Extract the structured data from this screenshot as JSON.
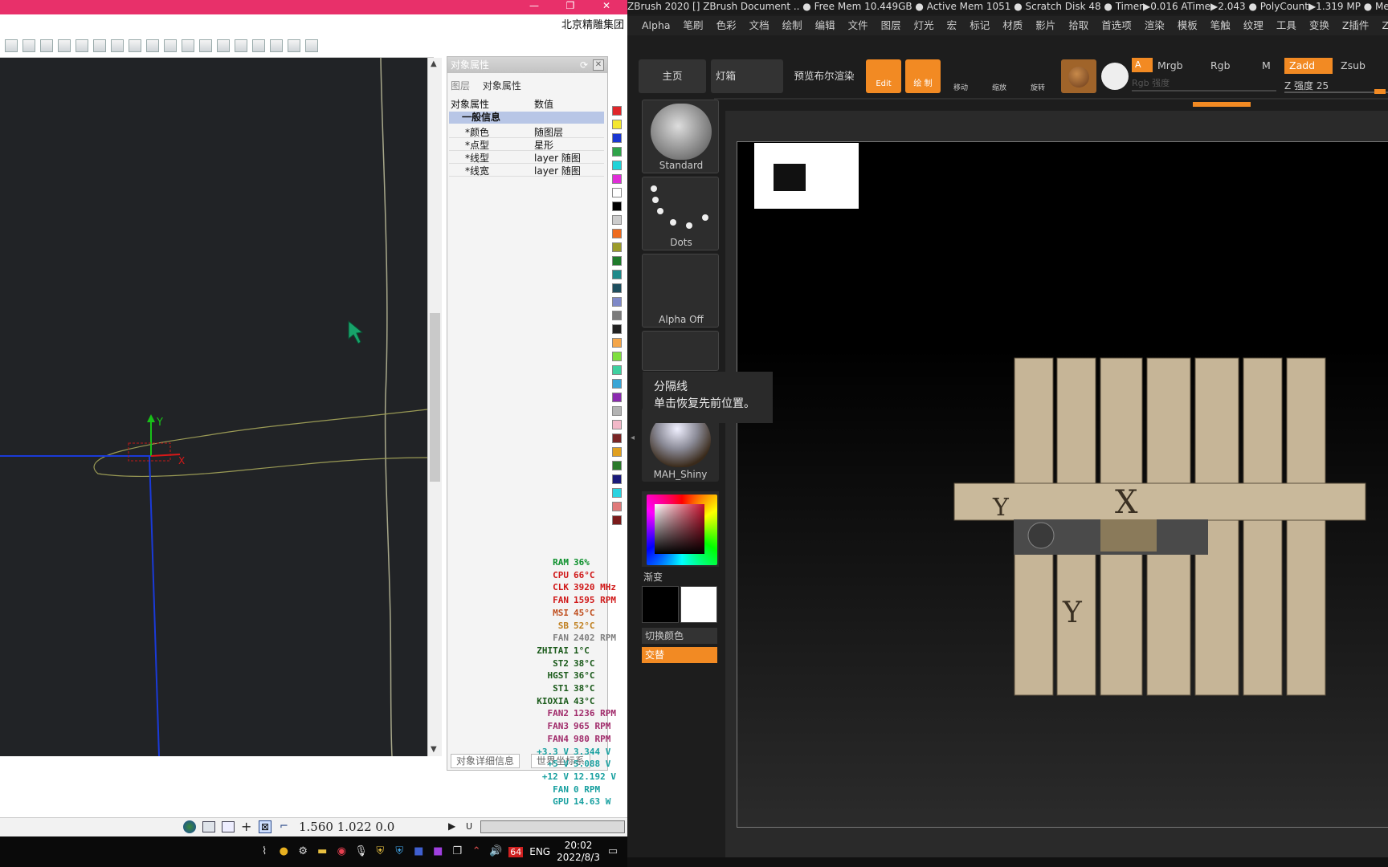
{
  "cad": {
    "company": "北京精雕集团",
    "coords": "1.560  1.022  0.0",
    "axis_y": "Y",
    "axis_x": "X",
    "progress_label": "U"
  },
  "props": {
    "title": "对象属性",
    "tab_layer": "图层",
    "tab_props": "对象属性",
    "col_name": "对象属性",
    "col_value": "数值",
    "group_label": "一般信息",
    "rows": [
      {
        "name": "*颜色",
        "value": "随图层"
      },
      {
        "name": "*点型",
        "value": "星形"
      },
      {
        "name": "*线型",
        "value": "layer 随图"
      },
      {
        "name": "*线宽",
        "value": "layer 随图"
      }
    ],
    "footer_detail": "对象详细信息",
    "footer_world": "世界坐标系",
    "colors": [
      "#e0262a",
      "#f4e72d",
      "#1a37d2",
      "#2fa34a",
      "#1fd3d8",
      "#e02ed8",
      "#ffffff",
      "#000000",
      "#cccccc",
      "#ee6b1e",
      "#9b9b2a",
      "#1f7a2b",
      "#1f8a8a",
      "#1e4f5f",
      "#7f89c8",
      "#7a7a7a",
      "#222222",
      "#f4a64a",
      "#7fdf3f",
      "#3fd0a0",
      "#3aa6d6",
      "#8b2ab0",
      "#b3b3b3",
      "#f2b8c8",
      "#7a2525",
      "#e0a020",
      "#2a7a2a",
      "#1a1a7a",
      "#2ad3e0",
      "#e07a7a",
      "#7a1a1a"
    ]
  },
  "hwmon": [
    {
      "k": "RAM",
      "v": "36%",
      "c": "#0a8f2a"
    },
    {
      "k": "CPU",
      "v": "66°C",
      "c": "#d01818"
    },
    {
      "k": "CLK",
      "v": "3920 MHz",
      "c": "#d01818"
    },
    {
      "k": "FAN",
      "v": "1595 RPM",
      "c": "#d01818"
    },
    {
      "k": "MSI",
      "v": "45°C",
      "c": "#c05020"
    },
    {
      "k": "SB",
      "v": "52°C",
      "c": "#c08020"
    },
    {
      "k": "FAN",
      "v": "2402 RPM",
      "c": "#808080"
    },
    {
      "k": "ZHITAI",
      "v": "1°C",
      "c": "#1a5a1a"
    },
    {
      "k": "ST2",
      "v": "38°C",
      "c": "#1a5a1a"
    },
    {
      "k": "HGST",
      "v": "36°C",
      "c": "#1a5a1a"
    },
    {
      "k": "ST1",
      "v": "38°C",
      "c": "#1a5a1a"
    },
    {
      "k": "KIOXIA",
      "v": "43°C",
      "c": "#1a5a1a"
    },
    {
      "k": "FAN2",
      "v": "1236 RPM",
      "c": "#a02a6a"
    },
    {
      "k": "FAN3",
      "v": "965 RPM",
      "c": "#a02a6a"
    },
    {
      "k": "FAN4",
      "v": "980 RPM",
      "c": "#a02a6a"
    },
    {
      "k": "+3.3 V",
      "v": "3.344 V",
      "c": "#18a0a0"
    },
    {
      "k": "+5 V",
      "v": "5.088 V",
      "c": "#18a0a0"
    },
    {
      "k": "+12 V",
      "v": "12.192 V",
      "c": "#18a0a0"
    },
    {
      "k": "FAN",
      "v": "0 RPM",
      "c": "#18a0a0"
    },
    {
      "k": "GPU",
      "v": "14.63 W",
      "c": "#18a0a0"
    }
  ],
  "taskbar": {
    "lang": "ENG",
    "badge": "64",
    "time": "20:02",
    "date": "2022/8/3"
  },
  "zbrush": {
    "title": "ZBrush 2020 []   ZBrush Document     .. ● Free Mem 10.449GB ● Active Mem 1051 ● Scratch Disk 48 ● Timer▶0.016 ATime▶2.043 ● PolyCount▶1.319 MP ● Mes",
    "menu": [
      "Alpha",
      "笔刷",
      "色彩",
      "文档",
      "绘制",
      "编辑",
      "文件",
      "图层",
      "灯光",
      "宏",
      "标记",
      "材质",
      "影片",
      "拾取",
      "首选项",
      "渲染",
      "模板",
      "笔触",
      "纹理",
      "工具",
      "变换",
      "Z插件",
      "Z脚本"
    ],
    "btn_home": "主页",
    "btn_lightbox": "灯箱",
    "btn_bpr": "预览布尔渲染",
    "btn_edit": "Edit",
    "btn_draw": "绘 制",
    "btn_move": "移动",
    "btn_scale": "缩放",
    "btn_rotate": "旋转",
    "a_label": "A",
    "mrgb": "Mrgb",
    "rgb": "Rgb",
    "m": "M",
    "zadd": "Zadd",
    "zsub": "Zsub",
    "rgb_intensity": "Rgb 强度",
    "z_intensity": "Z 强度 25",
    "brush_standard": "Standard",
    "stroke_dots": "Dots",
    "alpha_off": "Alpha Off",
    "material": "MAH_Shiny",
    "gradient": "渐变",
    "switch_color": "切换颜色",
    "alternate": "交替",
    "tooltip_title": "分隔线",
    "tooltip_body": "单击恢复先前位置。",
    "gizmo_x": "X",
    "gizmo_y": "Y",
    "accent": "#f28a23"
  }
}
